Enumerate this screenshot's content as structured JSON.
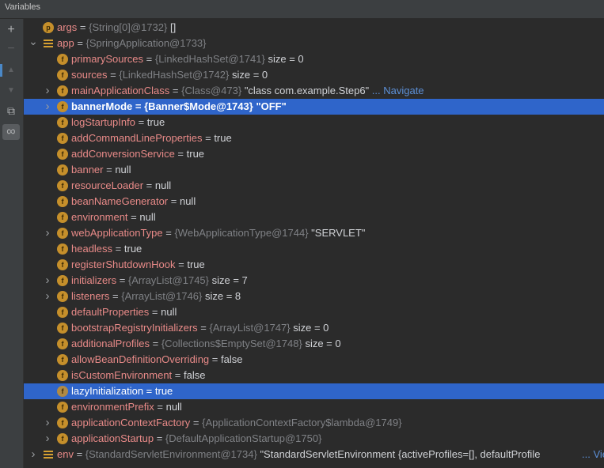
{
  "window": {
    "title": "Variables"
  },
  "toolbar": {
    "add": "+",
    "remove": "−",
    "up": "▲",
    "down": "▼",
    "copy": "⧉",
    "glasses": "∞"
  },
  "colors": {
    "selection": "#2f65ca",
    "field_name": "#e88a88",
    "icon": "#c58f2b",
    "link": "#5c8fd6"
  },
  "rows": [
    {
      "name": "args",
      "type": "{String[0]@1732}",
      "value": "[]",
      "icon": "p",
      "level": 0,
      "arrow": ""
    },
    {
      "name": "app",
      "type": "{SpringApplication@1733}",
      "value": "",
      "icon": "list",
      "level": 0,
      "arrow": "open"
    },
    {
      "name": "primarySources",
      "type": "{LinkedHashSet@1741}",
      "value": " size = 0",
      "icon": "f",
      "level": 1,
      "arrow": ""
    },
    {
      "name": "sources",
      "type": "{LinkedHashSet@1742}",
      "value": " size = 0",
      "icon": "f",
      "level": 1,
      "arrow": ""
    },
    {
      "name": "mainApplicationClass",
      "type": "{Class@473}",
      "value": "\"class com.example.Step6\"",
      "link": "... Navigate",
      "icon": "f",
      "level": 1,
      "arrow": "closed"
    },
    {
      "name": "bannerMode",
      "type": "{Banner$Mode@1743}",
      "value": "\"OFF\"",
      "icon": "f",
      "level": 1,
      "arrow": "closed",
      "selected": "bold"
    },
    {
      "name": "logStartupInfo",
      "type": "",
      "value": "true",
      "icon": "f",
      "level": 1,
      "arrow": ""
    },
    {
      "name": "addCommandLineProperties",
      "type": "",
      "value": "true",
      "icon": "f",
      "level": 1,
      "arrow": ""
    },
    {
      "name": "addConversionService",
      "type": "",
      "value": "true",
      "icon": "f",
      "level": 1,
      "arrow": ""
    },
    {
      "name": "banner",
      "type": "",
      "value": "null",
      "icon": "f",
      "level": 1,
      "arrow": ""
    },
    {
      "name": "resourceLoader",
      "type": "",
      "value": "null",
      "icon": "f",
      "level": 1,
      "arrow": ""
    },
    {
      "name": "beanNameGenerator",
      "type": "",
      "value": "null",
      "icon": "f",
      "level": 1,
      "arrow": ""
    },
    {
      "name": "environment",
      "type": "",
      "value": "null",
      "icon": "f",
      "level": 1,
      "arrow": ""
    },
    {
      "name": "webApplicationType",
      "type": "{WebApplicationType@1744}",
      "value": "\"SERVLET\"",
      "icon": "f",
      "level": 1,
      "arrow": "closed"
    },
    {
      "name": "headless",
      "type": "",
      "value": "true",
      "icon": "f",
      "level": 1,
      "arrow": ""
    },
    {
      "name": "registerShutdownHook",
      "type": "",
      "value": "true",
      "icon": "f",
      "level": 1,
      "arrow": ""
    },
    {
      "name": "initializers",
      "type": "{ArrayList@1745}",
      "value": " size = 7",
      "icon": "f",
      "level": 1,
      "arrow": "closed"
    },
    {
      "name": "listeners",
      "type": "{ArrayList@1746}",
      "value": " size = 8",
      "icon": "f",
      "level": 1,
      "arrow": "closed"
    },
    {
      "name": "defaultProperties",
      "type": "",
      "value": "null",
      "icon": "f",
      "level": 1,
      "arrow": ""
    },
    {
      "name": "bootstrapRegistryInitializers",
      "type": "{ArrayList@1747}",
      "value": " size = 0",
      "icon": "f",
      "level": 1,
      "arrow": ""
    },
    {
      "name": "additionalProfiles",
      "type": "{Collections$EmptySet@1748}",
      "value": " size = 0",
      "icon": "f",
      "level": 1,
      "arrow": ""
    },
    {
      "name": "allowBeanDefinitionOverriding",
      "type": "",
      "value": "false",
      "icon": "f",
      "level": 1,
      "arrow": ""
    },
    {
      "name": "isCustomEnvironment",
      "type": "",
      "value": "false",
      "icon": "f",
      "level": 1,
      "arrow": ""
    },
    {
      "name": "lazyInitialization",
      "type": "",
      "value": "true",
      "icon": "f",
      "level": 1,
      "arrow": "",
      "selected": "plain"
    },
    {
      "name": "environmentPrefix",
      "type": "",
      "value": "null",
      "icon": "f",
      "level": 1,
      "arrow": ""
    },
    {
      "name": "applicationContextFactory",
      "type": "{ApplicationContextFactory$lambda@1749}",
      "value": "",
      "icon": "f",
      "level": 1,
      "arrow": "closed"
    },
    {
      "name": "applicationStartup",
      "type": "{DefaultApplicationStartup@1750}",
      "value": "",
      "icon": "f",
      "level": 1,
      "arrow": "closed"
    },
    {
      "name": "env",
      "type": "{StandardServletEnvironment@1734}",
      "value": "\"StandardServletEnvironment {activeProfiles=[], defaultProfile",
      "link": "... View",
      "icon": "list",
      "level": 0,
      "arrow": "closed"
    }
  ]
}
